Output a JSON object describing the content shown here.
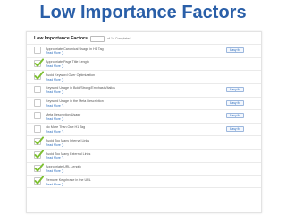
{
  "slide": {
    "title": "Low Importance Factors"
  },
  "panel": {
    "title": "Low Importance Factors",
    "count_text": "of 14 Completed"
  },
  "read_more_label": "Read More ❯",
  "colors": {
    "accent": "#2a5fa8",
    "check": "#7dc030",
    "link": "#2f6fbe"
  },
  "factors": [
    {
      "label": "Appropriate Canonical Usage in H1 Tag",
      "checked": false,
      "button": "Easy fix"
    },
    {
      "label": "Appropriate Page Title Length",
      "checked": true,
      "button": ""
    },
    {
      "label": "Avoid Keyword Over Optimization",
      "checked": true,
      "button": ""
    },
    {
      "label": "Keyword Usage in Bold/Strong/Emphasis/Italics",
      "checked": false,
      "button": "Easy fix"
    },
    {
      "label": "Keyword Usage in the Meta Description",
      "checked": false,
      "button": "Easy fix"
    },
    {
      "label": "Meta Description Usage",
      "checked": false,
      "button": "Easy fix"
    },
    {
      "label": "No More Than One H1 Tag",
      "checked": false,
      "button": "Easy fix"
    },
    {
      "label": "Avoid Too Many Internal Links",
      "checked": true,
      "button": ""
    },
    {
      "label": "Avoid Too Many External Links",
      "checked": true,
      "button": ""
    },
    {
      "label": "Appropriate URL Length",
      "checked": true,
      "button": ""
    },
    {
      "label": "Remove Keyphrase in the URL",
      "checked": true,
      "button": ""
    }
  ]
}
